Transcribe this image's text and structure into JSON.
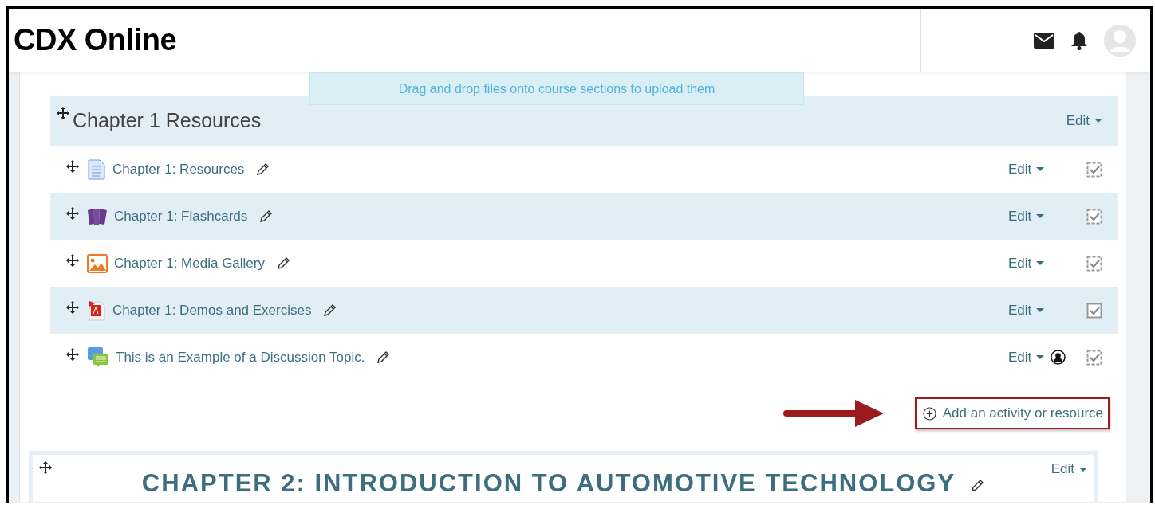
{
  "header": {
    "logo": "CDX Online"
  },
  "notice": "Drag and drop files onto course sections to upload them",
  "section_1": {
    "title": "Chapter 1 Resources",
    "edit": "Edit",
    "activities": [
      {
        "name": "Chapter 1: Resources",
        "kind": "page",
        "edit": "Edit",
        "group_mode": false,
        "automatic": true,
        "checked": true
      },
      {
        "name": "Chapter 1: Flashcards",
        "kind": "flashcards",
        "edit": "Edit",
        "group_mode": false,
        "automatic": true,
        "checked": true
      },
      {
        "name": "Chapter 1: Media Gallery",
        "kind": "gallery",
        "edit": "Edit",
        "group_mode": false,
        "automatic": true,
        "checked": true
      },
      {
        "name": "Chapter 1: Demos and Exercises",
        "kind": "pdf",
        "edit": "Edit",
        "group_mode": false,
        "automatic": false,
        "checked": true
      },
      {
        "name": "This is an Example of a Discussion Topic.",
        "kind": "forum",
        "edit": "Edit",
        "group_mode": true,
        "automatic": true,
        "checked": true
      }
    ],
    "add_button": "Add an activity or resource"
  },
  "section_2": {
    "title": "CHAPTER 2: INTRODUCTION TO AUTOMOTIVE TECHNOLOGY",
    "edit": "Edit"
  }
}
